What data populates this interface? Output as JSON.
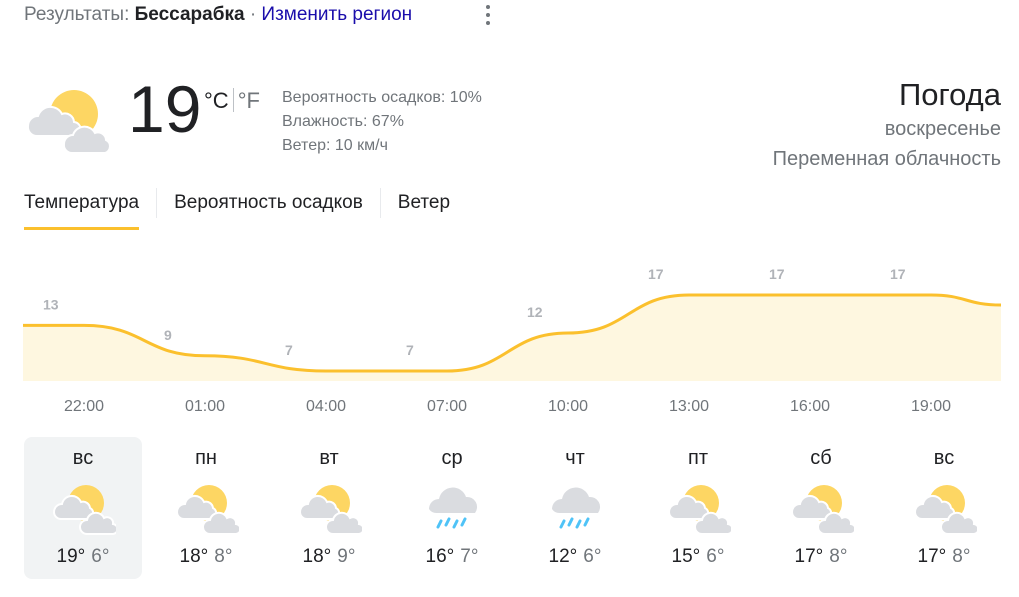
{
  "header": {
    "results_label": "Результаты:",
    "location": "Бессарабка",
    "separator": "·",
    "change_region": "Изменить регион"
  },
  "current": {
    "icon": "partly-cloudy-icon",
    "temperature": "19",
    "unit_c": "°C",
    "unit_f": "°F",
    "precipitation": "Вероятность осадков: 10%",
    "humidity": "Влажность: 67%",
    "wind": "Ветер: 10 км/ч"
  },
  "summary": {
    "title": "Погода",
    "day": "воскресенье",
    "condition": "Переменная облачность"
  },
  "tabs": [
    {
      "label": "Температура",
      "active": true
    },
    {
      "label": "Вероятность осадков",
      "active": false
    },
    {
      "label": "Ветер",
      "active": false
    }
  ],
  "colors": {
    "accent": "#fbc02d",
    "chart_line": "#fbc02d",
    "chart_fill": "#fef7e0",
    "sun": "#fdd663",
    "cloud": "#dadce0",
    "rain": "#4fc3f7"
  },
  "chart_data": {
    "type": "area",
    "x": [
      "22:00",
      "01:00",
      "04:00",
      "07:00",
      "10:00",
      "13:00",
      "16:00",
      "19:00"
    ],
    "values": [
      13,
      9,
      7,
      7,
      12,
      17,
      17,
      17
    ],
    "labels": [
      "13",
      "9",
      "7",
      "7",
      "12",
      "17",
      "17",
      "17"
    ]
  },
  "forecast": [
    {
      "day": "вс",
      "icon": "partly-cloudy-icon",
      "high": "19°",
      "low": "6°",
      "selected": true
    },
    {
      "day": "пн",
      "icon": "partly-cloudy-icon",
      "high": "18°",
      "low": "8°",
      "selected": false
    },
    {
      "day": "вт",
      "icon": "partly-cloudy-icon",
      "high": "18°",
      "low": "9°",
      "selected": false
    },
    {
      "day": "ср",
      "icon": "rain-icon",
      "high": "16°",
      "low": "7°",
      "selected": false
    },
    {
      "day": "чт",
      "icon": "rain-icon",
      "high": "12°",
      "low": "6°",
      "selected": false
    },
    {
      "day": "пт",
      "icon": "partly-cloudy-icon",
      "high": "15°",
      "low": "6°",
      "selected": false
    },
    {
      "day": "сб",
      "icon": "partly-cloudy-icon",
      "high": "17°",
      "low": "8°",
      "selected": false
    },
    {
      "day": "вс",
      "icon": "partly-cloudy-icon",
      "high": "17°",
      "low": "8°",
      "selected": false
    }
  ]
}
